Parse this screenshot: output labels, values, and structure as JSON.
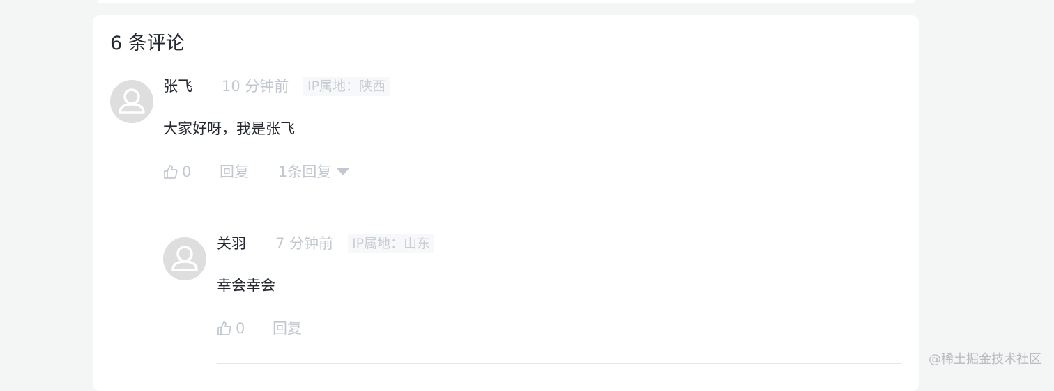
{
  "comments": {
    "heading": "6 条评论",
    "main": {
      "author": "张飞",
      "time": "10 分钟前",
      "ip": "IP属地：陕西",
      "content": "大家好呀，我是张飞",
      "likes": "0",
      "reply_label": "回复",
      "replies_toggle": "1条回复"
    },
    "reply": {
      "author": "关羽",
      "time": "7 分钟前",
      "ip": "IP属地：山东",
      "content": "幸会幸会",
      "likes": "0",
      "reply_label": "回复"
    }
  },
  "watermark": "@稀土掘金技术社区",
  "icons": {
    "avatar": "user-avatar-icon",
    "like": "thumbs-up-icon",
    "expand": "caret-down-icon"
  },
  "colors": {
    "background": "#f4f5f5",
    "card": "#ffffff",
    "text": "#252933",
    "muted": "#c2c8d1",
    "avatar": "#dedede"
  }
}
